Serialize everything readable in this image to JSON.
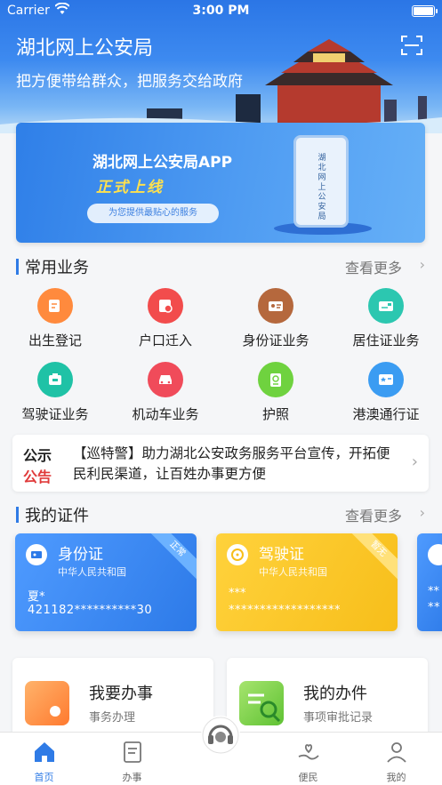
{
  "status_bar": {
    "carrier": "Carrier",
    "time": "3:00 PM"
  },
  "header": {
    "title": "湖北网上公安局",
    "subtitle": "把方便带给群众，把服务交给政府"
  },
  "banner": {
    "title": "湖北网上公安局APP",
    "tagline": "正式上线",
    "pill": "为您提供最贴心的服务",
    "phone_text": "湖北网上公安局"
  },
  "common_services": {
    "label": "常用业务",
    "more": "查看更多",
    "items": [
      {
        "name": "出生登记",
        "color": "#ff8a3d",
        "icon": "edit-doc-icon"
      },
      {
        "name": "户口迁入",
        "color": "#f24c4c",
        "icon": "household-icon"
      },
      {
        "name": "身份证业务",
        "color": "#b5683d",
        "icon": "id-card-icon"
      },
      {
        "name": "居住证业务",
        "color": "#2cc7b0",
        "icon": "residence-card-icon"
      },
      {
        "name": "驾驶证业务",
        "color": "#1fc2a6",
        "icon": "license-icon"
      },
      {
        "name": "机动车业务",
        "color": "#f04b5a",
        "icon": "car-icon"
      },
      {
        "name": "护照",
        "color": "#6fd23f",
        "icon": "passport-icon"
      },
      {
        "name": "港澳通行证",
        "color": "#3b9cf2",
        "icon": "travel-permit-icon"
      }
    ]
  },
  "notice": {
    "tag_line1": "公示",
    "tag_line2": "公告",
    "text": "【巡特警】助力湖北公安政务服务平台宣传，开拓便民利民渠道，让百姓办事更方便"
  },
  "documents": {
    "label": "我的证件",
    "more": "查看更多",
    "cards": [
      {
        "name": "身份证",
        "org": "中华人民共和国",
        "ribbon": "正常",
        "line1": "夏*",
        "line2": "421182**********30"
      },
      {
        "name": "驾驶证",
        "org": "中华人民共和国",
        "ribbon": "暂无",
        "line1": "***",
        "line2": "******************"
      }
    ],
    "third_card_lines": [
      "**",
      "**"
    ]
  },
  "entries": [
    {
      "title": "我要办事",
      "subtitle": "事务办理",
      "color": "#ff8a3d"
    },
    {
      "title": "我的办件",
      "subtitle": "事项审批记录",
      "color": "#7dd44a"
    }
  ],
  "tabbar": {
    "tabs": [
      {
        "label": "首页",
        "icon": "home-icon"
      },
      {
        "label": "办事",
        "icon": "document-icon"
      },
      {
        "label": "",
        "icon": "headset-icon"
      },
      {
        "label": "便民",
        "icon": "heart-hand-icon"
      },
      {
        "label": "我的",
        "icon": "user-icon"
      }
    ]
  },
  "colors": {
    "accent": "#2f7be6",
    "notice_red": "#e03a3a"
  }
}
